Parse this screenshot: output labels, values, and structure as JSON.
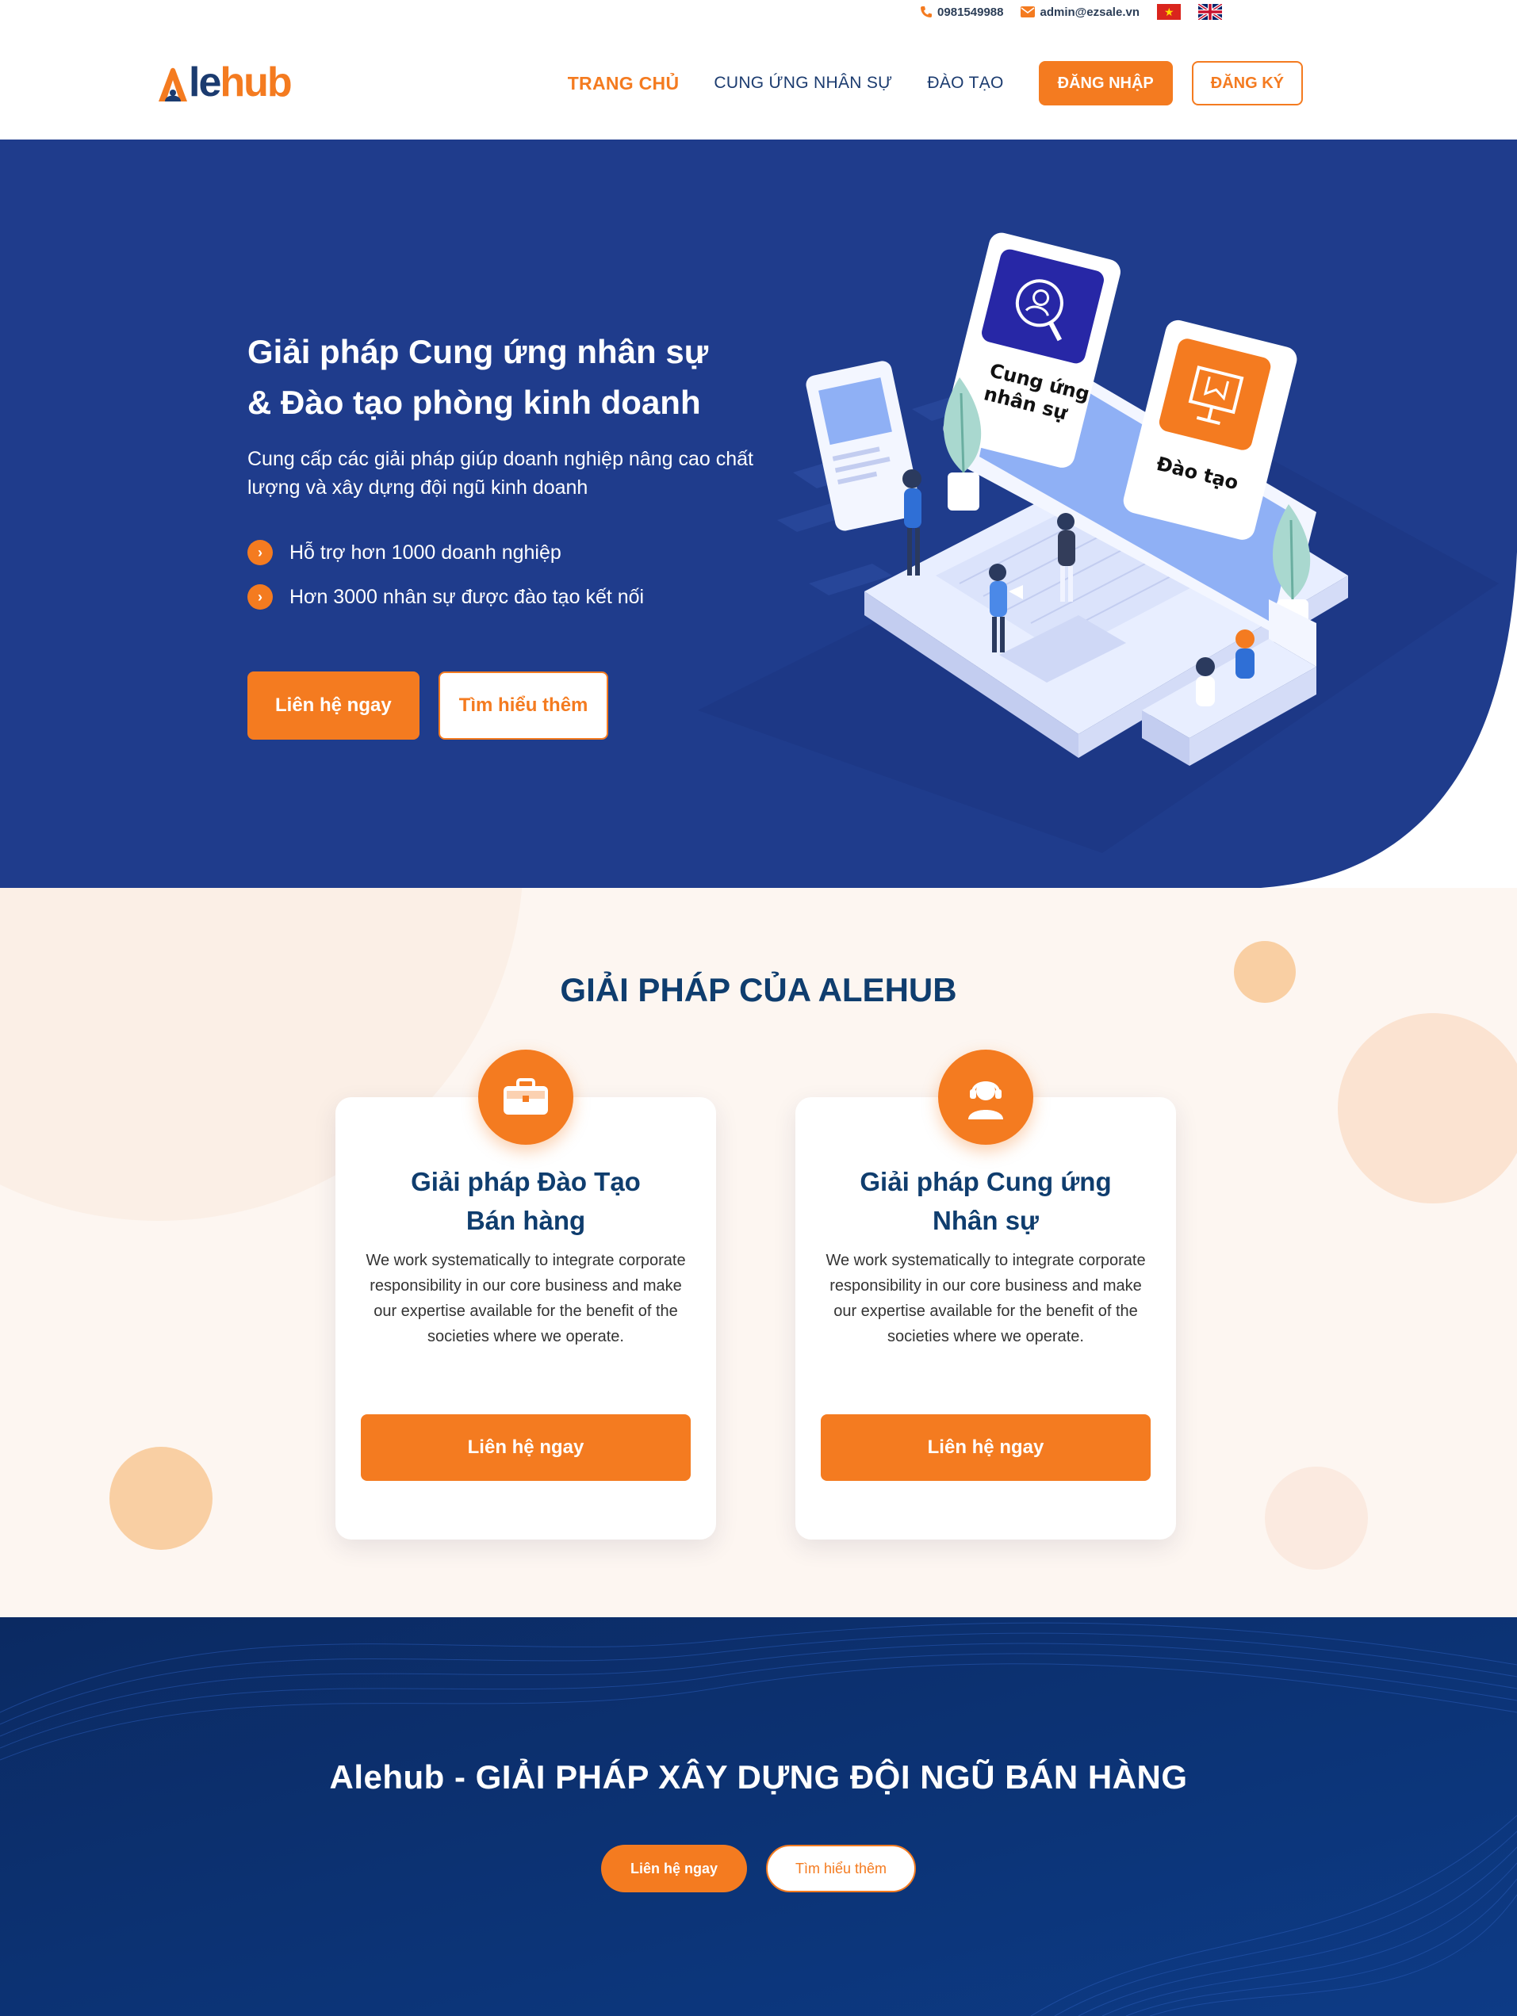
{
  "topbar": {
    "phone": "0981549988",
    "email": "admin@ezsale.vn",
    "phone_icon": "phone-icon",
    "email_icon": "mail-icon",
    "lang_vn": "flag-vietnam-icon",
    "lang_en": "flag-uk-icon"
  },
  "header": {
    "logo_a": "A",
    "logo_le": "le",
    "logo_hub": "hub",
    "nav": {
      "home": "TRANG CHỦ",
      "staffing": "CUNG ỨNG NHÂN SỰ",
      "training": "ĐÀO TẠO",
      "login": "ĐĂNG NHẬP",
      "register": "ĐĂNG KÝ"
    }
  },
  "hero": {
    "title_line1": "Giải pháp Cung ứng nhân sự",
    "title_line2": "& Đào tạo phòng kinh doanh",
    "subtitle": "Cung cấp các giải pháp giúp doanh nghiệp nâng cao chất lượng và xây dựng đội ngũ kinh doanh",
    "points": [
      "Hỗ trợ hơn 1000 doanh nghiệp",
      "Hơn 3000 nhân sự được đào tạo kết nối"
    ],
    "btn_contact": "Liên hệ ngay",
    "btn_learn": "Tìm hiểu thêm",
    "illus_card1": "Cung ứng nhân sự",
    "illus_card2": "Đào tạo"
  },
  "solutions": {
    "title": "GIẢI PHÁP CỦA ALEHUB",
    "cards": [
      {
        "icon": "briefcase-icon",
        "title_line1": "Giải pháp Đào Tạo",
        "title_line2": "Bán hàng",
        "desc": "We work systematically to integrate corporate responsibility in our core business and make our expertise available for the benefit of the societies where we operate.",
        "btn": "Liên hệ ngay"
      },
      {
        "icon": "support-agent-icon",
        "title_line1": "Giải pháp Cung ứng",
        "title_line2": "Nhân sự",
        "desc": "We work systematically to integrate corporate responsibility in our core business and make our expertise available for the benefit of the societies where we operate.",
        "btn": "Liên hệ ngay"
      }
    ]
  },
  "cta": {
    "title": "Alehub - GIẢI PHÁP XÂY DỰNG ĐỘI NGŨ BÁN HÀNG",
    "btn_contact": "Liên hệ ngay",
    "btn_learn": "Tìm hiểu thêm"
  },
  "colors": {
    "brand_orange": "#f47b20",
    "brand_navy": "#1b3b6f",
    "hero_bg": "#1f3c8c",
    "solutions_bg": "#fdf6f1",
    "cta_bg": "#0a2d69"
  }
}
